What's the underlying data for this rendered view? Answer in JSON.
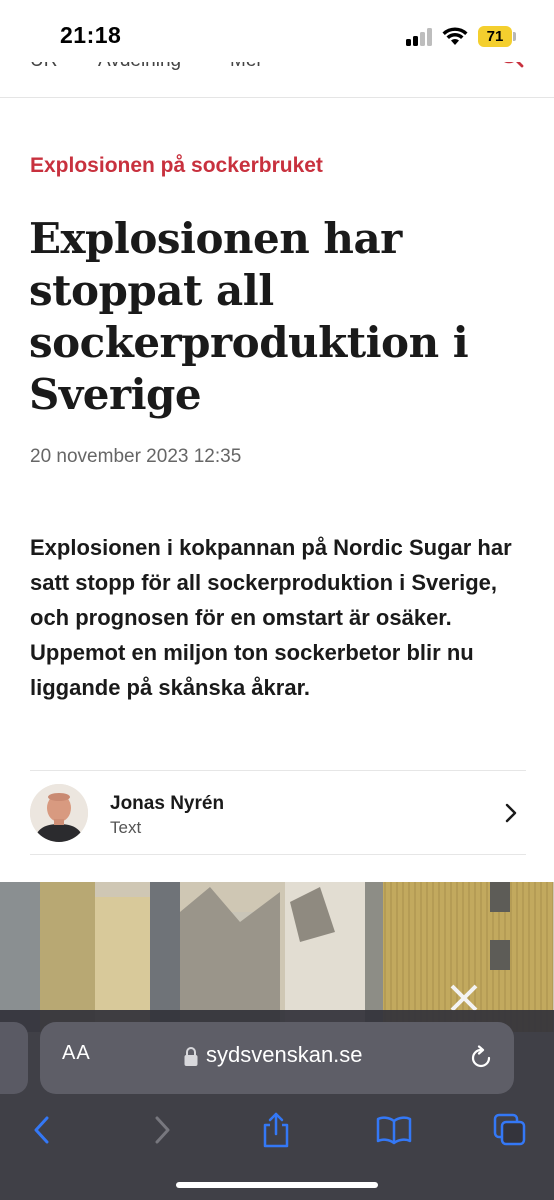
{
  "status_bar": {
    "time": "21:18",
    "battery_level": "71"
  },
  "site_nav": {
    "items": [
      "UR",
      "Avdelning",
      "Mer"
    ]
  },
  "article": {
    "kicker": "Explosionen på sockerbruket",
    "headline": "Explosionen har stoppat all sockerproduktion i Sverige",
    "date": "20 november 2023 12:35",
    "lead": "Explosionen i kokpannan på Nordic Sugar har satt stopp för all sockerproduktion i Sverige, och prognosen för en omstart är osäker. Uppemot en miljon ton sockerbetor blir nu liggande på skånska åkrar."
  },
  "author": {
    "name": "Jonas Nyrén",
    "role": "Text"
  },
  "browser": {
    "aa_label": "AA",
    "url": "sydsvenskan.se"
  },
  "colors": {
    "accent": "#c8313e",
    "ios_blue": "#3478f6",
    "battery": "#f4cf2e"
  },
  "icons": [
    "search-icon",
    "chevron-right-icon",
    "lock-icon",
    "reload-icon",
    "back-icon",
    "forward-icon",
    "share-icon",
    "bookmarks-icon",
    "tabs-icon"
  ]
}
